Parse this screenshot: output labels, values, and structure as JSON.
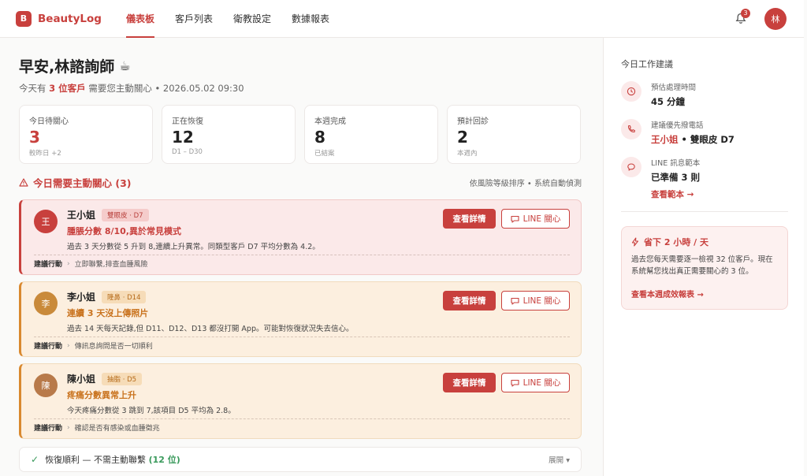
{
  "app": {
    "logo_letter": "B",
    "name": "BeautyLog"
  },
  "nav": [
    {
      "label": "儀表板",
      "active": true
    },
    {
      "label": "客戶列表",
      "active": false
    },
    {
      "label": "衛教設定",
      "active": false
    },
    {
      "label": "數據報表",
      "active": false
    }
  ],
  "header": {
    "notification_count": "3",
    "user_initial": "林"
  },
  "greeting": {
    "title": "早安,林諮詢師",
    "icon": "coffee-icon",
    "sub_prefix": "今天有",
    "sub_highlight": "3 位客戶",
    "sub_suffix": "需要您主動關心 • 2026.05.02 09:30"
  },
  "stats": [
    {
      "label": "今日待關心",
      "value": "3",
      "note": "較昨日 +2",
      "highlight": true
    },
    {
      "label": "正在恢復",
      "value": "12",
      "note": "D1 – D30",
      "highlight": false
    },
    {
      "label": "本週完成",
      "value": "8",
      "note": "已結案",
      "highlight": false
    },
    {
      "label": "預計回診",
      "value": "2",
      "note": "本週內",
      "highlight": false
    }
  ],
  "alerts_section": {
    "title": "今日需要主動關心 (3)",
    "note": "依風險等級排序 • 系統自動偵測"
  },
  "alerts": [
    {
      "initial": "王",
      "name": "王小姐",
      "tag": "雙眼皮 · D7",
      "alert": "腫脹分數 8/10,異於常見模式",
      "desc": "過去 3 天分數從 5 升到 8,連續上升異常。同類型客戶 D7 平均分數為 4.2。",
      "suggest_label": "建議行動",
      "suggest": "立即聯繫,排查血腫風險",
      "level": "red",
      "avatar_color": "#c8403d"
    },
    {
      "initial": "李",
      "name": "李小姐",
      "tag": "隆鼻 · D14",
      "alert": "連續 3 天沒上傳照片",
      "desc": "過去 14 天每天記錄,但 D11、D12、D13 都沒打開 App。可能對恢復狀況失去信心。",
      "suggest_label": "建議行動",
      "suggest": "傳訊息詢問是否一切順利",
      "level": "orange",
      "avatar_color": "#c98a3a"
    },
    {
      "initial": "陳",
      "name": "陳小姐",
      "tag": "抽脂 · D5",
      "alert": "疼痛分數異常上升",
      "desc": "今天疼痛分數從 3 跳到 7,該項目 D5 平均為 2.8。",
      "suggest_label": "建議行動",
      "suggest": "確認是否有感染或血腫徵兆",
      "level": "orange",
      "avatar_color": "#b87a4a"
    }
  ],
  "buttons": {
    "detail": "查看詳情",
    "line": "LINE 關心"
  },
  "recovery_bar": {
    "text": "恢復順利 — 不需主動聯繫",
    "count": "(12 位)",
    "expand": "展開"
  },
  "right_panel": {
    "title": "今日工作建議",
    "items": [
      {
        "icon": "clock-icon",
        "label": "預估處理時間",
        "value": "45 分鐘"
      },
      {
        "icon": "phone-icon",
        "label": "建議優先撥電話",
        "value_red": "王小姐",
        "value_rest": " • 雙眼皮 D7"
      },
      {
        "icon": "chat-icon",
        "label": "LINE 訊息範本",
        "value": "已準備 3 則",
        "link": "查看範本 →"
      }
    ],
    "save_card": {
      "title": "省下 2 小時 / 天",
      "desc": "過去您每天需要逐一檢視 32 位客戶。現在系統幫您找出真正需要關心的 3 位。",
      "link": "查看本週成效報表 →"
    }
  },
  "colors": {
    "brand": "#c8403d",
    "warning": "#d9892f",
    "success": "#3a9a5c"
  }
}
